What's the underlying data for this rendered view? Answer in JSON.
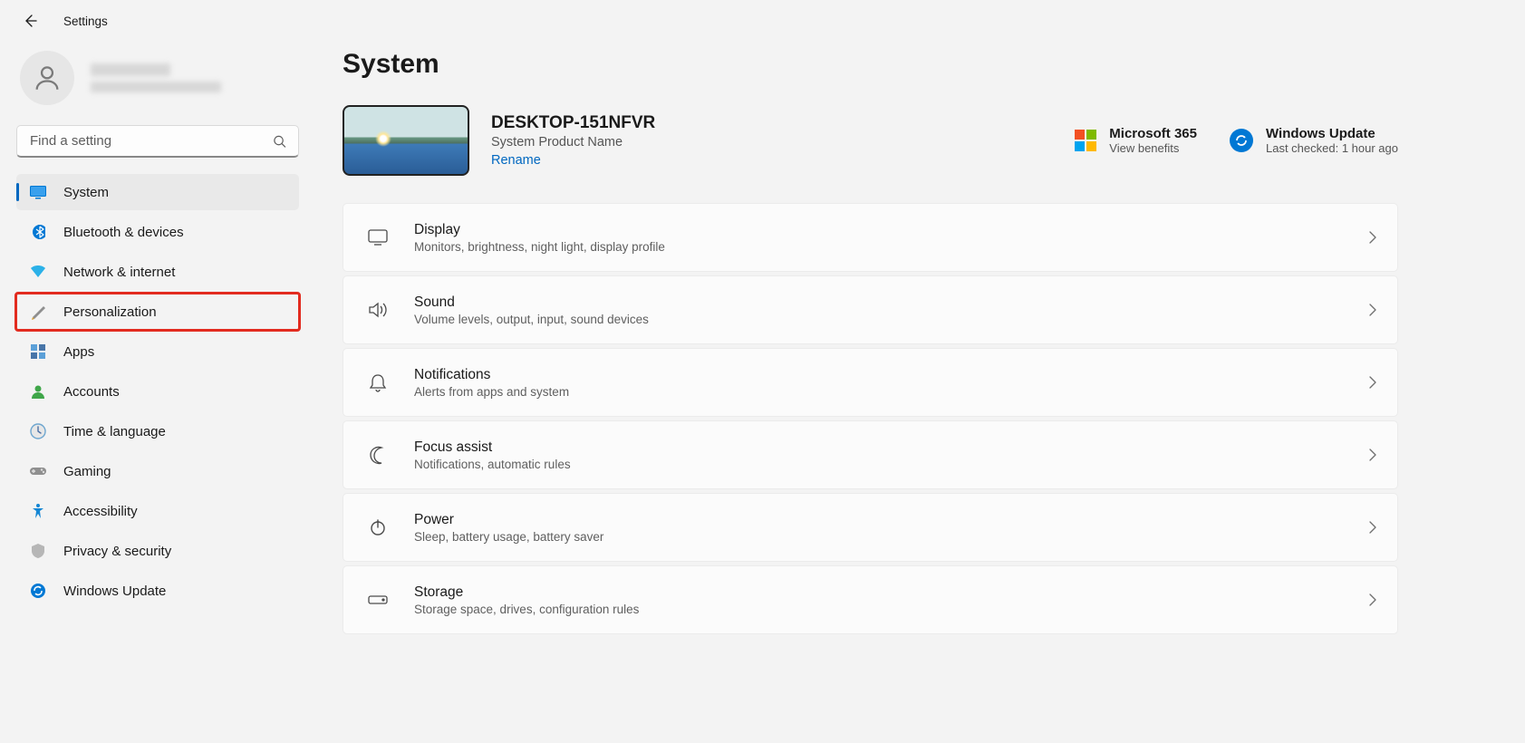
{
  "app_title": "Settings",
  "search": {
    "placeholder": "Find a setting"
  },
  "sidebar": {
    "items": [
      {
        "label": "System"
      },
      {
        "label": "Bluetooth & devices"
      },
      {
        "label": "Network & internet"
      },
      {
        "label": "Personalization"
      },
      {
        "label": "Apps"
      },
      {
        "label": "Accounts"
      },
      {
        "label": "Time & language"
      },
      {
        "label": "Gaming"
      },
      {
        "label": "Accessibility"
      },
      {
        "label": "Privacy & security"
      },
      {
        "label": "Windows Update"
      }
    ]
  },
  "page": {
    "title": "System",
    "device_name": "DESKTOP-151NFVR",
    "product_name": "System Product Name",
    "rename_label": "Rename",
    "ms365": {
      "title": "Microsoft 365",
      "sub": "View benefits"
    },
    "wu": {
      "title": "Windows Update",
      "sub": "Last checked: 1 hour ago"
    },
    "cards": [
      {
        "title": "Display",
        "sub": "Monitors, brightness, night light, display profile"
      },
      {
        "title": "Sound",
        "sub": "Volume levels, output, input, sound devices"
      },
      {
        "title": "Notifications",
        "sub": "Alerts from apps and system"
      },
      {
        "title": "Focus assist",
        "sub": "Notifications, automatic rules"
      },
      {
        "title": "Power",
        "sub": "Sleep, battery usage, battery saver"
      },
      {
        "title": "Storage",
        "sub": "Storage space, drives, configuration rules"
      }
    ]
  }
}
